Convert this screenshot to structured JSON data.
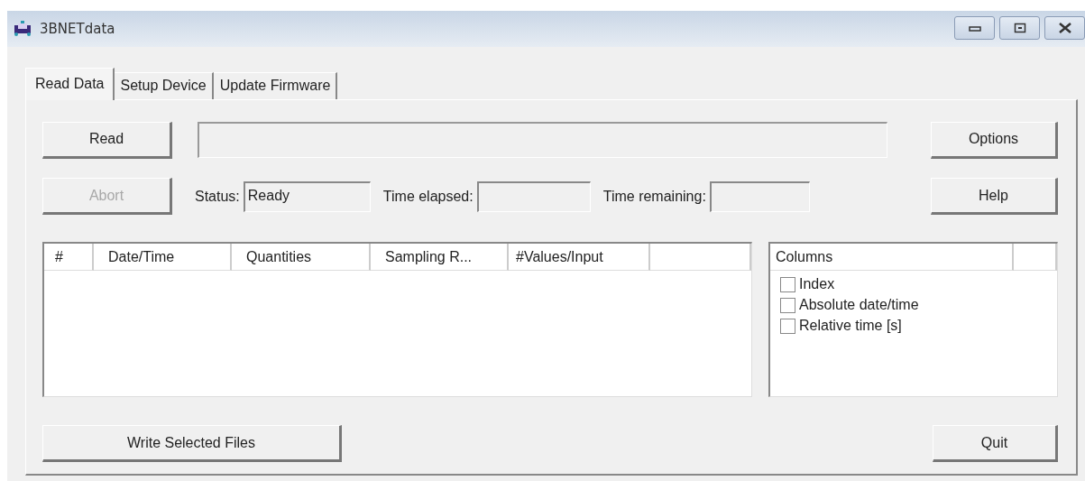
{
  "window": {
    "title": "3BNETdata"
  },
  "tabs": [
    {
      "label": "Read Data",
      "selected": true
    },
    {
      "label": "Setup Device",
      "selected": false
    },
    {
      "label": "Update Firmware",
      "selected": false
    }
  ],
  "buttons": {
    "read": {
      "label": "Read",
      "disabled": false
    },
    "abort": {
      "label": "Abort",
      "disabled": true
    },
    "options": {
      "label": "Options",
      "disabled": false
    },
    "help": {
      "label": "Help",
      "disabled": false
    },
    "write": {
      "label": "Write Selected Files",
      "disabled": false
    },
    "quit": {
      "label": "Quit",
      "disabled": false
    }
  },
  "progress": {
    "level": 0
  },
  "fields": [
    {
      "label": "Status:",
      "value": "Ready"
    },
    {
      "label": "Time elapsed:"
    },
    {
      "label": "Time remaining:"
    }
  ],
  "file_list": {
    "columns": [
      "#",
      "Date/Time",
      "Quantities",
      "Sampling R...",
      "#Values/Input"
    ]
  },
  "columns_panel": {
    "heading": "Columns",
    "items": [
      {
        "label": "Index",
        "checked": false
      },
      {
        "label": "Absolute date/time",
        "checked": false
      },
      {
        "label": "Relative time [s]",
        "checked": false
      }
    ]
  }
}
